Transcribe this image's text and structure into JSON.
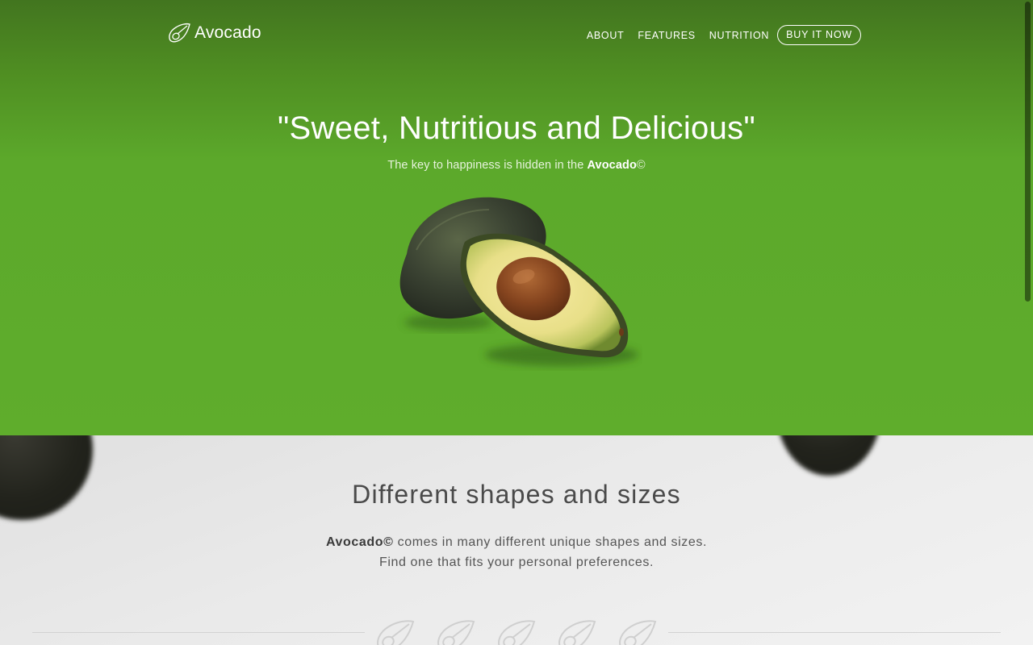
{
  "brand": {
    "name": "Avocado",
    "logo_icon": "avocado-outline-icon"
  },
  "nav": {
    "links": [
      "ABOUT",
      "FEATURES",
      "NUTRITION"
    ],
    "cta": "BUY IT NOW"
  },
  "hero": {
    "headline": "\"Sweet, Nutritious and Delicious\"",
    "subline_prefix": "The key to happiness is hidden in the ",
    "subline_brand": "Avocado",
    "subline_suffix": "©",
    "image_icon": "avocado-halves-icon"
  },
  "shapes_section": {
    "title": "Different shapes and sizes",
    "line1_brand": "Avocado©",
    "line1_rest": " comes in many different unique shapes and sizes.",
    "line2": "Find one that fits your personal preferences.",
    "divider_icon": "avocado-outline-icon",
    "divider_icon_count": 5
  },
  "colors": {
    "hero_green": "#5fad2c",
    "hero_dark_green": "#42751f",
    "section_bg": "#ececec",
    "text_dark": "#4a4a4a"
  }
}
